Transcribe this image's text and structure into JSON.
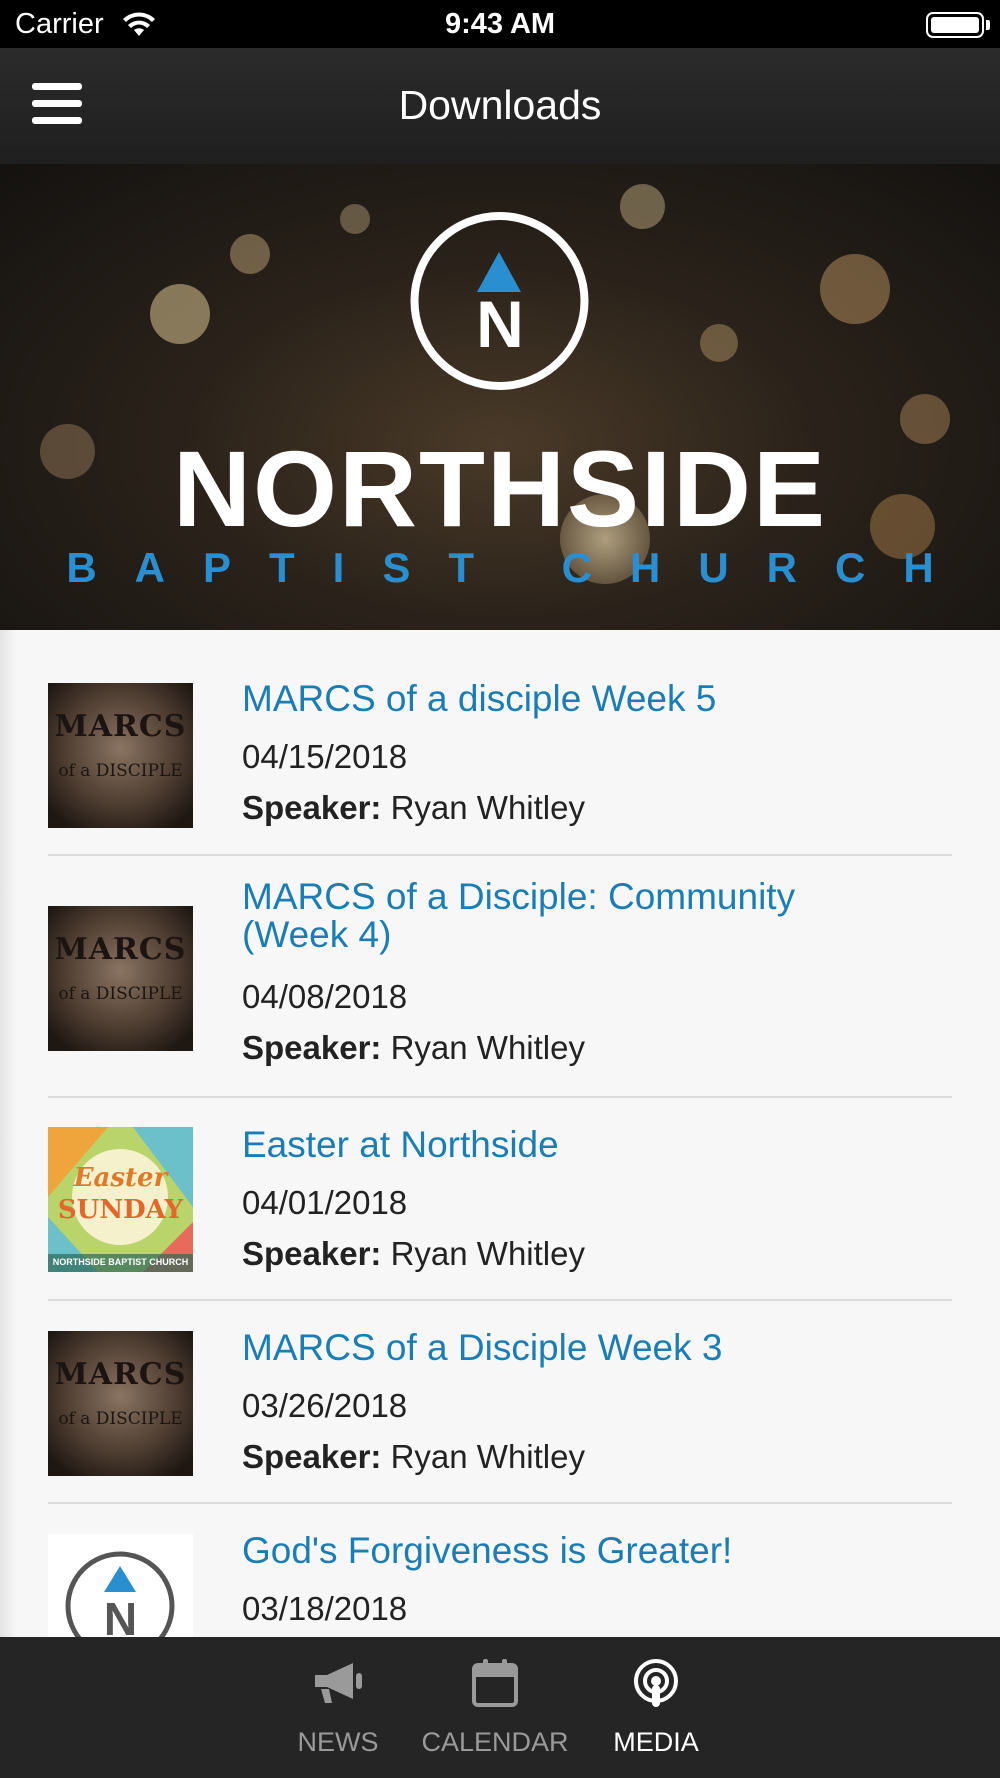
{
  "status_bar": {
    "carrier": "Carrier",
    "time": "9:43 AM"
  },
  "nav": {
    "title": "Downloads"
  },
  "banner": {
    "brand_name": "NORTHSIDE",
    "brand_sub": "BAPTIST CHURCH",
    "logo_letter": "N"
  },
  "items": [
    {
      "title": "MARCS of a disciple Week 5",
      "date": "04/15/2018",
      "speaker_label": "Speaker:",
      "speaker": "Ryan Whitley",
      "thumb": "marcs"
    },
    {
      "title": "MARCS of a Disciple: Community (Week 4)",
      "date": "04/08/2018",
      "speaker_label": "Speaker:",
      "speaker": "Ryan Whitley",
      "thumb": "marcs"
    },
    {
      "title": "Easter at Northside",
      "date": "04/01/2018",
      "speaker_label": "Speaker:",
      "speaker": "Ryan Whitley",
      "thumb": "easter"
    },
    {
      "title": "MARCS of a Disciple Week 3",
      "date": "03/26/2018",
      "speaker_label": "Speaker:",
      "speaker": "Ryan Whitley",
      "thumb": "marcs"
    },
    {
      "title": "God's Forgiveness is Greater!",
      "date": "03/18/2018",
      "thumb": "logo"
    }
  ],
  "thumbs": {
    "marcs": {
      "line1": "MARCS",
      "line2": "of a DISCIPLE"
    },
    "easter": {
      "line1": "Easter",
      "line2": "SUNDAY",
      "footer": "NORTHSIDE BAPTIST CHURCH"
    }
  },
  "tabs": [
    {
      "label": "NEWS",
      "icon": "megaphone-icon",
      "active": false
    },
    {
      "label": "CALENDAR",
      "icon": "calendar-icon",
      "active": false
    },
    {
      "label": "MEDIA",
      "icon": "podcast-icon",
      "active": true
    }
  ],
  "colors": {
    "accent_blue": "#2a8fd0",
    "link_blue": "#1a7db5",
    "tab_bar": "#252525"
  }
}
